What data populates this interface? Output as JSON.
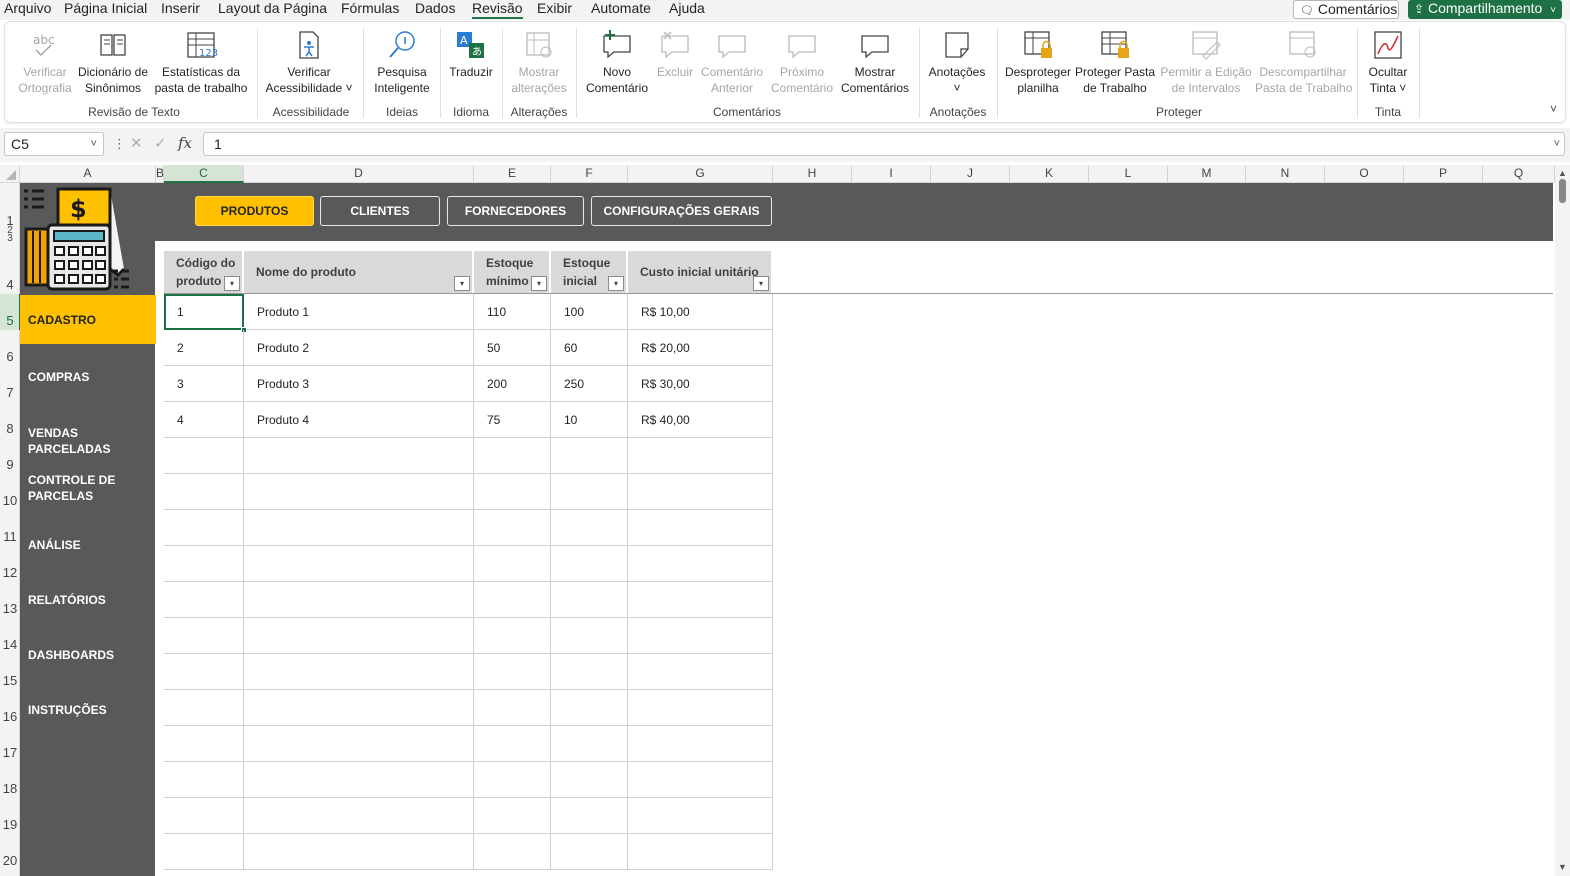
{
  "menu": {
    "tabs": [
      {
        "label": "Arquivo"
      },
      {
        "label": "Página Inicial"
      },
      {
        "label": "Inserir"
      },
      {
        "label": "Layout da Página"
      },
      {
        "label": "Fórmulas"
      },
      {
        "label": "Dados"
      },
      {
        "label": "Revisão"
      },
      {
        "label": "Exibir"
      },
      {
        "label": "Automate"
      },
      {
        "label": "Ajuda"
      }
    ],
    "active_tab": "Revisão",
    "comments_button": "Comentários",
    "share_button": "Compartilhamento"
  },
  "ribbon": {
    "buttons": {
      "spelling": [
        "Verificar",
        "Ortografia"
      ],
      "thesaurus": [
        "Dicionário de",
        "Sinônimos"
      ],
      "stats": [
        "Estatísticas da",
        "pasta de trabalho"
      ],
      "accessibility": [
        "Verificar",
        "Acessibilidade ˅"
      ],
      "smart_lookup": [
        "Pesquisa",
        "Inteligente"
      ],
      "translate": [
        "Traduzir"
      ],
      "show_changes": [
        "Mostrar",
        "alterações"
      ],
      "new_comment": [
        "Novo",
        "Comentário"
      ],
      "delete": [
        "Excluir"
      ],
      "prev_comment": [
        "Comentário",
        "Anterior"
      ],
      "next_comment": [
        "Próximo",
        "Comentário"
      ],
      "show_comments": [
        "Mostrar",
        "Comentários"
      ],
      "notes": [
        "Anotações",
        "˅"
      ],
      "unprotect_sheet": [
        "Desproteger",
        "planilha"
      ],
      "protect_workbook": [
        "Proteger Pasta",
        "de Trabalho"
      ],
      "allow_edit_ranges": [
        "Permitir a Edição",
        "de Intervalos"
      ],
      "unshare_workbook": [
        "Descompartilhar",
        "Pasta de Trabalho"
      ],
      "hide_ink": [
        "Ocultar",
        "Tinta ˅"
      ]
    },
    "groups": {
      "proofing": "Revisão de Texto",
      "accessibility": "Acessibilidade",
      "insights": "Ideias",
      "language": "Idioma",
      "changes": "Alterações",
      "comments": "Comentários",
      "notes": "Anotações",
      "protect": "Proteger",
      "ink": "Tinta"
    }
  },
  "formula_bar": {
    "name_box": "C5",
    "dots": "⋮",
    "cancel": "✕",
    "enter": "✓",
    "fx": "fx",
    "value": "1"
  },
  "grid": {
    "columns": [
      "A",
      "B",
      "C",
      "D",
      "E",
      "F",
      "G",
      "H",
      "I",
      "J",
      "K",
      "L",
      "M",
      "N",
      "O",
      "P",
      "Q"
    ],
    "selected_column": "C",
    "rows": [
      "1",
      "2",
      "3",
      "4",
      "5",
      "6",
      "7",
      "8",
      "9",
      "10",
      "11",
      "12",
      "13",
      "14",
      "15",
      "16",
      "17",
      "18",
      "19",
      "20"
    ],
    "selected_row": "5"
  },
  "sheet_nav": {
    "tabs": [
      "PRODUTOS",
      "CLIENTES",
      "FORNECEDORES",
      "CONFIGURAÇÕES GERAIS"
    ],
    "active": "PRODUTOS",
    "sidebar": [
      "CADASTRO",
      "COMPRAS",
      "VENDAS PARCELADAS",
      "CONTROLE DE PARCELAS",
      "ANÁLISE",
      "RELATÓRIOS",
      "DASHBOARDS",
      "INSTRUÇÕES"
    ],
    "sidebar_active": "CADASTRO"
  },
  "table": {
    "headers": [
      [
        "Código do",
        "produto"
      ],
      [
        "Nome do produto"
      ],
      [
        "Estoque",
        "mínimo"
      ],
      [
        "Estoque",
        "inicial"
      ],
      [
        "Custo inicial unitário"
      ]
    ],
    "filter_glyph": "▾",
    "rows": [
      [
        "1",
        "Produto 1",
        "110",
        "100",
        "R$ 10,00"
      ],
      [
        "2",
        "Produto 2",
        "50",
        "60",
        "R$ 20,00"
      ],
      [
        "3",
        "Produto 3",
        "200",
        "250",
        "R$ 30,00"
      ],
      [
        "4",
        "Produto 4",
        "75",
        "10",
        "R$ 40,00"
      ]
    ]
  },
  "colors": {
    "accent_green": "#217346",
    "nav_dark": "#595959",
    "highlight_yellow": "#ffc000"
  }
}
